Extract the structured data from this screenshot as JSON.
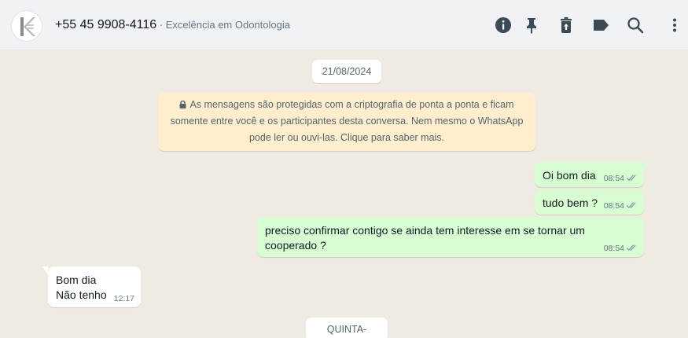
{
  "header": {
    "contact_name": "+55 45 9908-4116",
    "contact_subtitle": " · Excelência em Odontologia",
    "icons": [
      "info-icon",
      "pin-icon",
      "trash-icon",
      "label-icon",
      "search-icon",
      "menu-icon"
    ]
  },
  "chat": {
    "date_chip_1": "21/08/2024",
    "encryption_notice": "As mensagens são protegidas com a criptografia de ponta a ponta e ficam somente entre você e os participantes desta conversa. Nem mesmo o WhatsApp pode ler ou ouvi-las. Clique para saber mais.",
    "messages": [
      {
        "direction": "out",
        "text": "Oi bom dia",
        "time": "08:54",
        "status": "read"
      },
      {
        "direction": "out",
        "text": "tudo bem ?",
        "time": "08:54",
        "status": "read"
      },
      {
        "direction": "out",
        "text_line1": "preciso confirmar contigo se ainda tem interesse em se tornar um",
        "text_line2": "cooperado ?",
        "time": "08:54",
        "status": "read"
      },
      {
        "direction": "in",
        "text_line1": "Bom dia",
        "text_line2": "Não tenho",
        "time": "12:17"
      }
    ],
    "date_chip_2": "QUINTA-FEIRA"
  },
  "colors": {
    "background": "#efeae2",
    "outgoing_bubble": "#d9fdd3",
    "incoming_bubble": "#ffffff",
    "notice_bg": "#ffeecd",
    "header_bg": "#f0f2f5",
    "icon": "#54656f"
  }
}
